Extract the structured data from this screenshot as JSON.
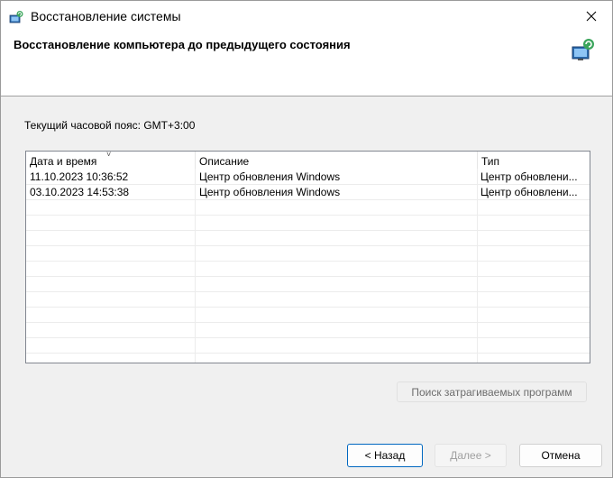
{
  "window": {
    "title": "Восстановление системы",
    "header_title": "Восстановление компьютера до предыдущего состояния"
  },
  "timezone": {
    "text": "Текущий часовой пояс: GMT+3:00"
  },
  "table": {
    "columns": [
      "Дата и время",
      "Описание",
      "Тип"
    ],
    "rows": [
      {
        "date": "11.10.2023 10:36:52",
        "description": "Центр обновления Windows",
        "type": "Центр обновлени..."
      },
      {
        "date": "03.10.2023 14:53:38",
        "description": "Центр обновления Windows",
        "type": "Центр обновлени..."
      }
    ],
    "sort_indicator": "˅"
  },
  "buttons": {
    "scan": "Поиск затрагиваемых программ",
    "back": "< Назад",
    "next": "Далее >",
    "cancel": "Отмена"
  },
  "icons": {
    "title": "system-restore-icon",
    "header": "system-restore-icon",
    "close": "close-icon"
  },
  "colors": {
    "accent": "#0067c0",
    "disabled_text": "#a0a0a0"
  }
}
